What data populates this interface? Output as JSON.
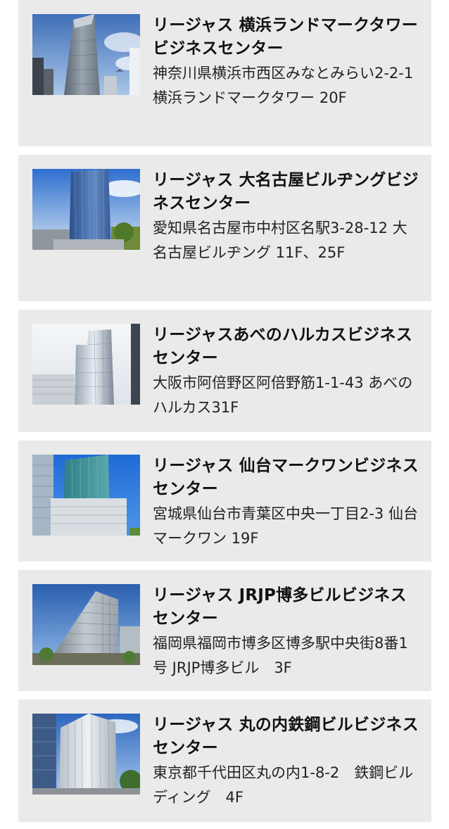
{
  "centers": [
    {
      "name": "リージャス 横浜ランドマークタワービジネスセンター",
      "address": "神奈川県横浜市西区みなとみらい2-2-1 横浜ランドマークタワー 20F",
      "image": "yokohama-landmark-tower-photo"
    },
    {
      "name": "リージャス 大名古屋ビルヂングビジネスセンター",
      "address": "愛知県名古屋市中村区名駅3-28-12 大名古屋ビルヂング 11F、25F",
      "image": "dai-nagoya-building-photo"
    },
    {
      "name": "リージャスあべのハルカスビジネスセンター",
      "address": "大阪市阿倍野区阿倍野筋1-1-43 あべのハルカス31F",
      "image": "abeno-harukas-photo"
    },
    {
      "name": "リージャス 仙台マークワンビジネスセンター",
      "address": "宮城県仙台市青葉区中央一丁目2-3 仙台マークワン 19F",
      "image": "sendai-mark-one-photo"
    },
    {
      "name": "リージャス JRJP博多ビルビジネスセンター",
      "address": "福岡県福岡市博多区博多駅中央街8番1号 JRJP博多ビル　3F",
      "image": "jrjp-hakata-building-photo"
    },
    {
      "name": "リージャス 丸の内鉄鋼ビルビジネスセンター",
      "address": "東京都千代田区丸の内1-8-2　鉄鋼ビルディング　4F",
      "image": "marunouchi-tekko-building-photo"
    }
  ]
}
